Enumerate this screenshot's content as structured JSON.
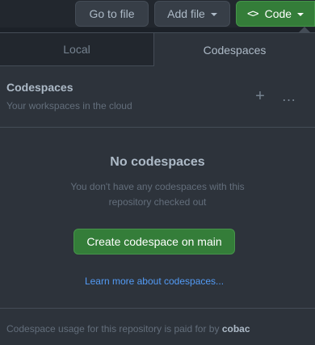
{
  "toolbar": {
    "go_to_file": "Go to file",
    "add_file": "Add file",
    "code_icon": "<>",
    "code": "Code"
  },
  "tabs": [
    {
      "label": "Local",
      "selected": false
    },
    {
      "label": "Codespaces",
      "selected": true
    }
  ],
  "codespaces": {
    "title": "Codespaces",
    "subtitle": "Your workspaces in the cloud",
    "add_icon": "+",
    "more_icon": "…"
  },
  "empty": {
    "title": "No codespaces",
    "description": "You don't have any codespaces with this repository checked out",
    "create_button": "Create codespace on main",
    "learn_more": "Learn more about codespaces..."
  },
  "footer": {
    "text": "Codespace usage for this repository is paid for by",
    "owner": "cobac"
  },
  "colors": {
    "accent_green": "#347d39",
    "link_blue": "#539bf5",
    "panel_bg": "#2d333b"
  }
}
